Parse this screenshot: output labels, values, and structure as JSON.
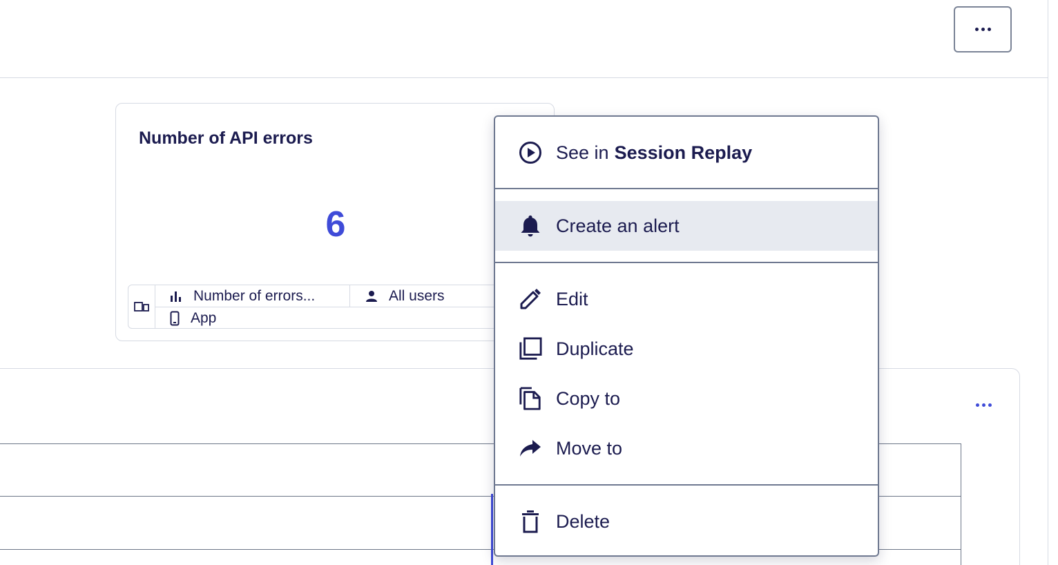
{
  "kpi_tile": {
    "title": "Number of API errors",
    "value": "6",
    "meta": {
      "metric": "Number of errors...",
      "segment": "All users",
      "platform": "App"
    }
  },
  "menu": {
    "see_in_prefix": "See in",
    "see_in_target": "Session Replay",
    "items": [
      {
        "label": "Create an alert",
        "icon": "bell-icon"
      },
      {
        "label": "Edit",
        "icon": "pencil-icon"
      },
      {
        "label": "Duplicate",
        "icon": "duplicate-icon"
      },
      {
        "label": "Copy to",
        "icon": "copy-icon"
      },
      {
        "label": "Move to",
        "icon": "move-arrow-icon"
      },
      {
        "label": "Delete",
        "icon": "trash-icon"
      }
    ]
  },
  "colors": {
    "accent": "#3f4bd8",
    "text": "#1b1b4f",
    "highlight": "#e7eaf0",
    "border": "#d6dae3"
  }
}
